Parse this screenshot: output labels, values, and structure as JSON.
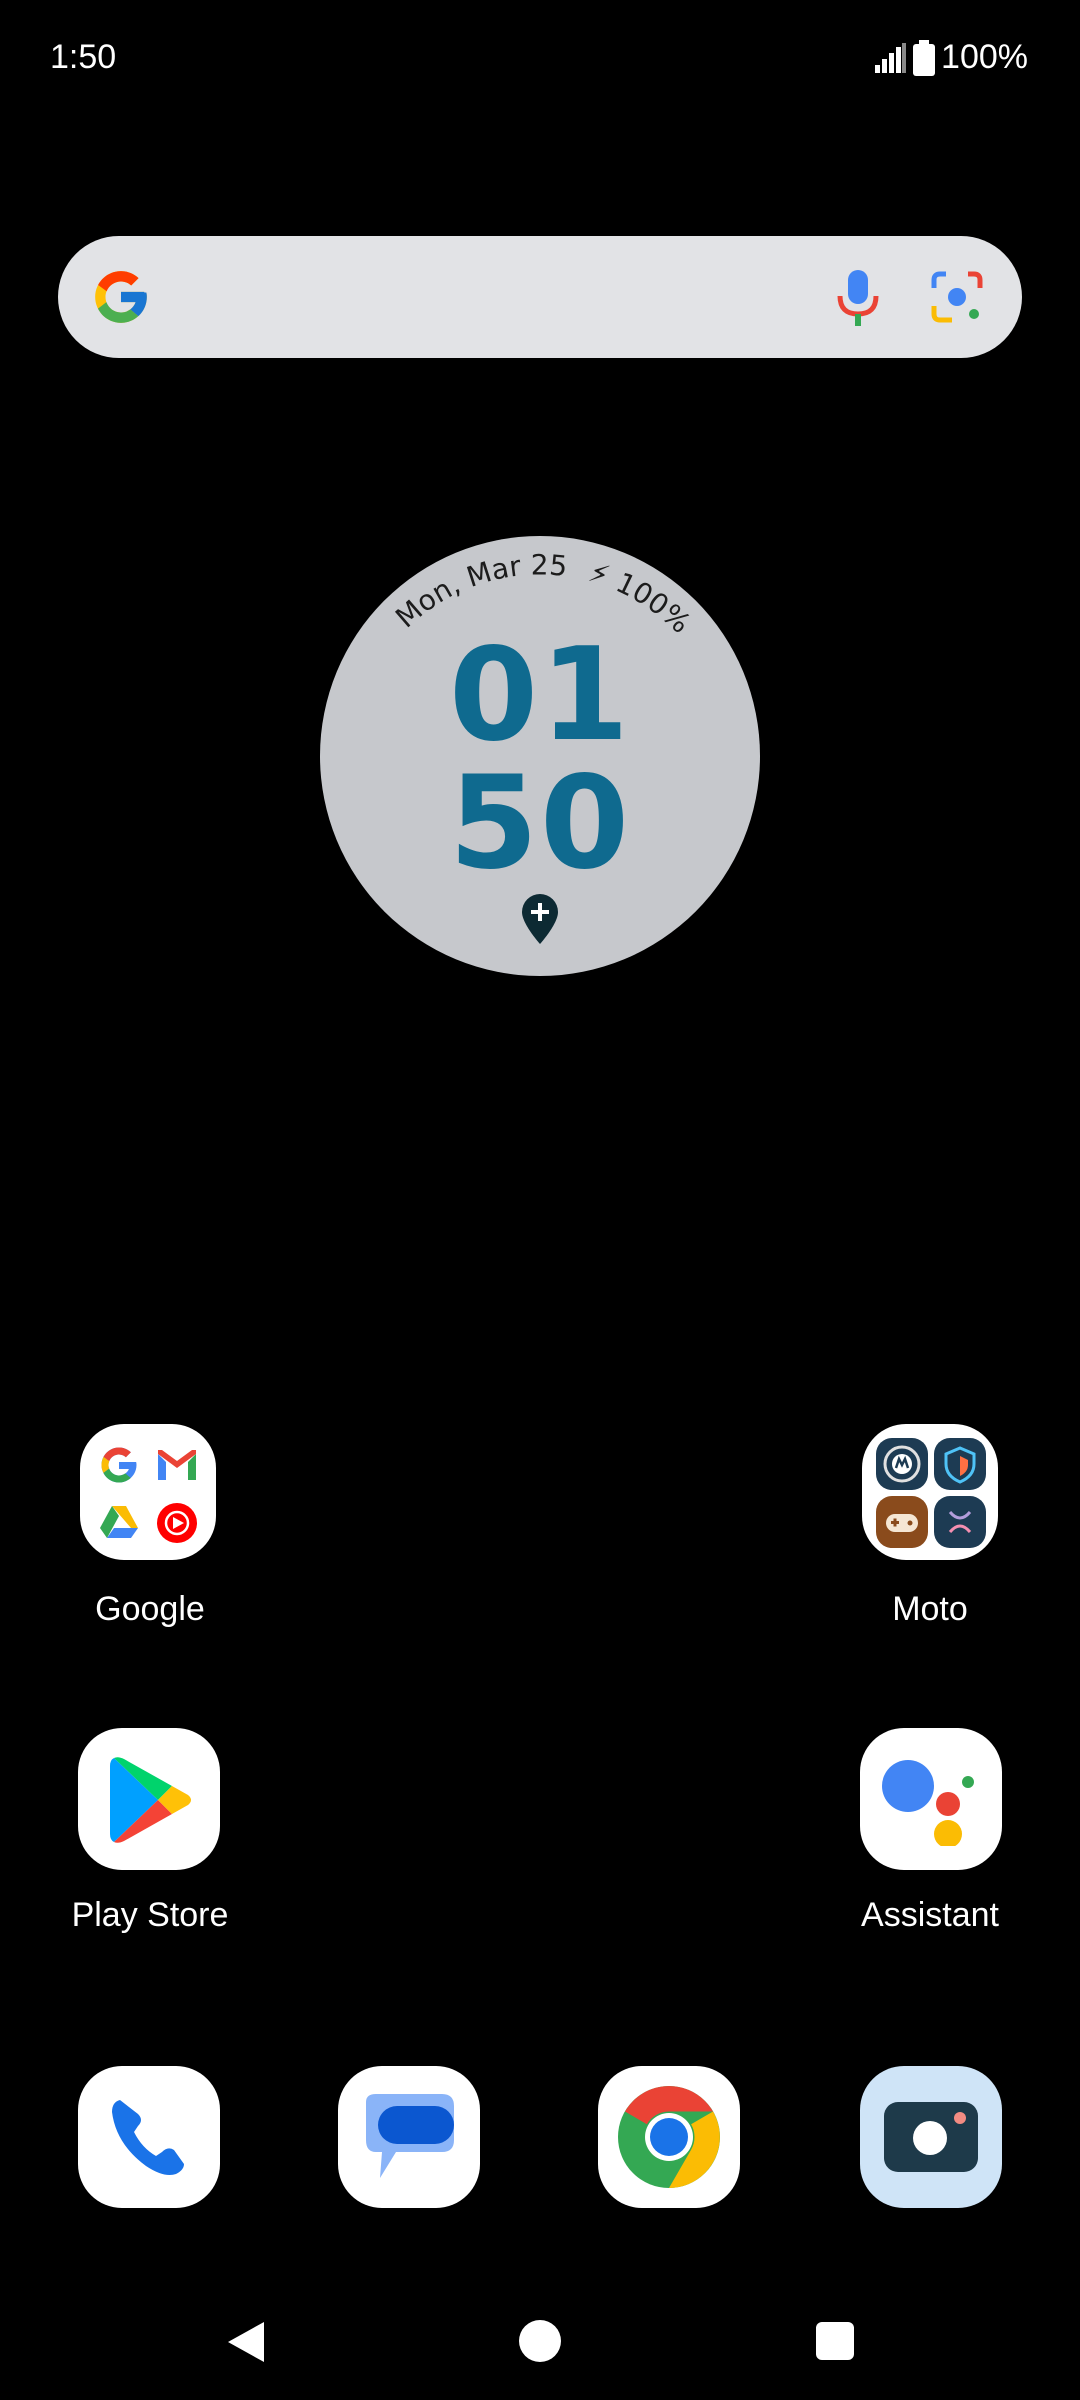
{
  "status_bar": {
    "time": "1:50",
    "battery": "100%"
  },
  "search": {
    "mic_icon": "mic-icon",
    "lens_icon": "lens-icon"
  },
  "clock_widget": {
    "date": "Mon, Mar 25",
    "battery": "100%",
    "hour": "01",
    "minute": "50",
    "location_icon": "location-add-icon"
  },
  "home_apps": [
    {
      "name": "Google"
    },
    {
      "name": "Moto"
    },
    {
      "name": "Play Store"
    },
    {
      "name": "Assistant"
    }
  ],
  "dock": [
    {
      "name": "Phone"
    },
    {
      "name": "Messages"
    },
    {
      "name": "Chrome"
    },
    {
      "name": "Camera"
    }
  ],
  "colors": {
    "clock_digits": "#0f6a8f",
    "widget_bg": "#c6c8cc",
    "search_bg": "#e2e3e6"
  }
}
